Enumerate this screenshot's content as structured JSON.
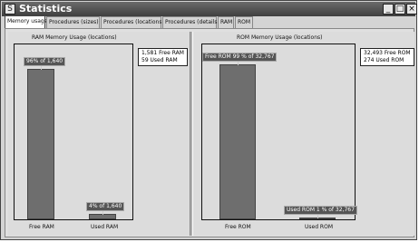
{
  "window": {
    "title": "Statistics",
    "controls": {
      "minimize": "_",
      "restore": "□",
      "close": "×"
    }
  },
  "tabs": [
    {
      "label": "Memory usage"
    },
    {
      "label": "Procedures (sizes)"
    },
    {
      "label": "Procedures (locations)"
    },
    {
      "label": "Procedures (details)"
    },
    {
      "label": "RAM"
    },
    {
      "label": "ROM"
    }
  ],
  "chart_data": [
    {
      "type": "bar",
      "title": "RAM Memory Usage (locations)",
      "categories": [
        "Free RAM",
        "Used RAM"
      ],
      "values": [
        1581,
        59
      ],
      "total": 1640,
      "bar_labels": [
        "96% of 1,640",
        "4% of 1,640"
      ],
      "legend": [
        "1,581 Free RAM",
        "59 Used RAM"
      ],
      "legend_placement": "right"
    },
    {
      "type": "bar",
      "title": "ROM Memory Usage (locations)",
      "categories": [
        "Free ROM",
        "Used ROM"
      ],
      "values": [
        32493,
        274
      ],
      "total": 32767,
      "bar_labels": [
        "Free ROM 99 % of 32,767",
        "Used ROM 1 % of 32,767"
      ],
      "legend": [
        "32,493 Free ROM",
        "274 Used ROM"
      ],
      "legend_placement": "right"
    }
  ]
}
